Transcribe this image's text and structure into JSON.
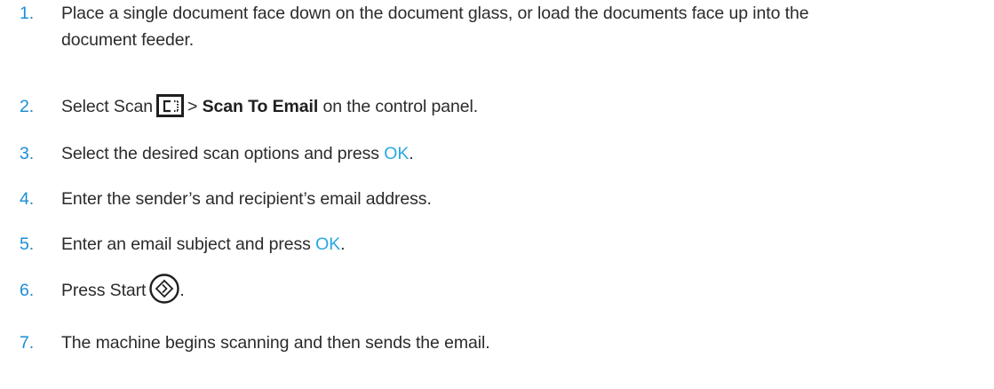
{
  "steps": [
    {
      "number": "1.",
      "line1": "Place a single document face down on the document glass, or load the documents face up into the",
      "line2": "document feeder."
    },
    {
      "number": "2.",
      "prefix": "Select Scan",
      "separator": ">",
      "menu_item": "Scan To Email",
      "suffix": "on the control panel.",
      "icon": "scan-icon"
    },
    {
      "number": "3.",
      "prefix": "Select the desired scan options and press",
      "key": "OK",
      "suffix": "."
    },
    {
      "number": "4.",
      "text": "Enter the sender’s and recipient’s email address."
    },
    {
      "number": "5.",
      "prefix": "Enter an email subject and press",
      "key": "OK",
      "suffix": "."
    },
    {
      "number": "6.",
      "prefix": "Press Start",
      "suffix": ".",
      "icon": "start-icon"
    },
    {
      "number": "7.",
      "text": "The machine begins scanning and then sends the email."
    }
  ],
  "colors": {
    "number": "#1a8ed6",
    "key_accent": "#2aa8e0",
    "text": "#2b2b2b"
  }
}
